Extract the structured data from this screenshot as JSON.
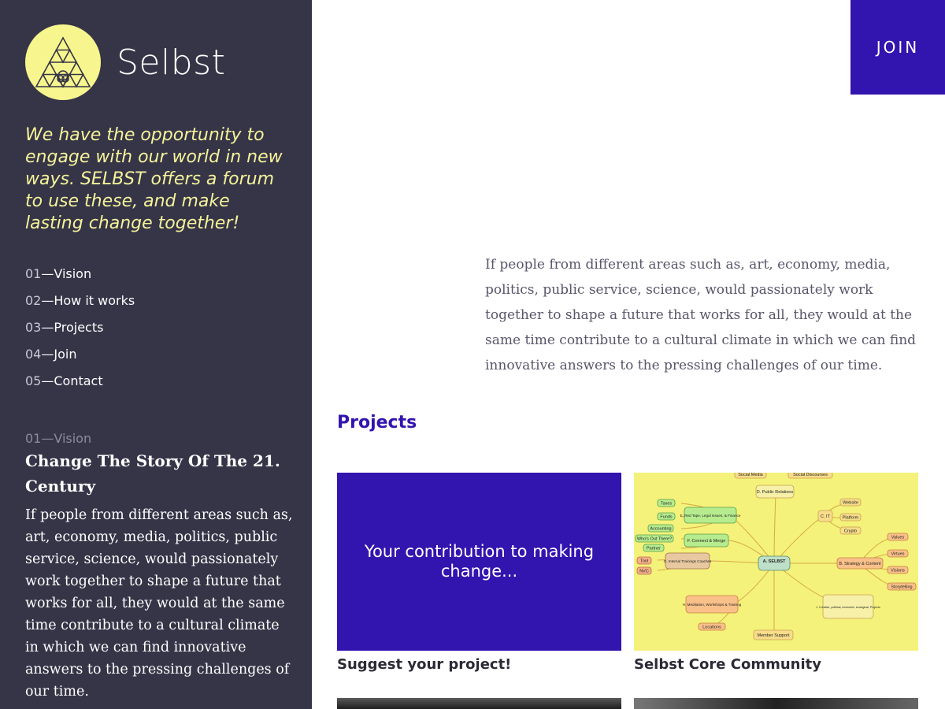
{
  "brand": {
    "name": "Selbst",
    "logo_icon": "triangle-sierpinski-icon",
    "logo_color": "#f7f68e"
  },
  "sidebar": {
    "background": "#363447",
    "tagline": "We have the opportunity to engage with our world in new ways. SELBST offers a forum to use these, and make lasting change together!",
    "nav": [
      {
        "num": "01",
        "label": "Vision"
      },
      {
        "num": "02",
        "label": "How it works"
      },
      {
        "num": "03",
        "label": "Projects"
      },
      {
        "num": "04",
        "label": "Join"
      },
      {
        "num": "05",
        "label": "Contact"
      }
    ],
    "section": {
      "label": "01—Vision",
      "title": "Change The Story Of The 21. Century",
      "body": "If people from different areas such as, art, economy, media, politics, public service, science, would passionately work together to shape a future that works for all, they would at the same time contribute to a cultural climate in which we can find innovative answers to the pressing challenges of our time."
    }
  },
  "header": {
    "join_label": "JOIN",
    "accent": "#3214af"
  },
  "main": {
    "intro": "If people from different areas such as, art, economy, media, politics, public service, science, would passionately work together to shape a future that works for all, they would at the same time contribute to a cultural climate in which we can find innovative answers to the pressing challenges of our time.",
    "projects_heading": "Projects",
    "projects": [
      {
        "thumb_text": "Your contribution to making change...",
        "title": "Suggest your project!"
      },
      {
        "title": "Selbst Core Community",
        "mindmap": {
          "center": "A. SELBST",
          "nodes": [
            "Social Media",
            "Social Discourses",
            "D. Public Relations",
            "Website",
            "C. IT",
            "Platform",
            "Crypto",
            "Taxes",
            "E. Red Tape, Legal Issues, & Finance",
            "Funds",
            "Accounting",
            "Who's Out There?",
            "F. Connect & Merge",
            "Partner",
            "Tool",
            "G. Internal Trainings Coaches",
            "NVC",
            "Values",
            "B. Strategy & Content",
            "Virtues",
            "Visions",
            "Storytelling",
            "H. Meditation, Workshops & Training",
            "Locations",
            "J. Creative, political, economic, ecological, Projects",
            "Member Support"
          ]
        }
      }
    ]
  }
}
